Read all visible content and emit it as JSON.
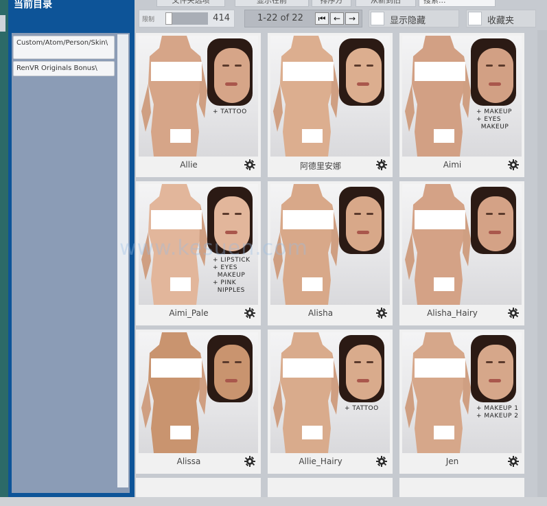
{
  "sidebar": {
    "title": "当前目录",
    "folders": [
      "Custom/Atom/Person/Skin\\",
      "RenVR Originals Bonus\\"
    ]
  },
  "toolbar": {
    "top_buttons": [
      "文件夹选项",
      "显示在前",
      "排序方",
      "从新到旧",
      "搜索..."
    ],
    "limit_label": "限制",
    "limit_value": "414",
    "pager_label": "1-22 of 22",
    "show_hidden": "显示隐藏",
    "favorites": "收藏夹"
  },
  "items": [
    {
      "name": "Allie",
      "tag": "+ TATTOO"
    },
    {
      "name": "阿德里安娜",
      "tag": ""
    },
    {
      "name": "Aimi",
      "tag": "+ MAKEUP\n+ EYES\n  MAKEUP"
    },
    {
      "name": "Aimi_Pale",
      "tag": "+ LIPSTICK\n+ EYES\n  MAKEUP\n+ PINK\n  NIPPLES"
    },
    {
      "name": "Alisha",
      "tag": ""
    },
    {
      "name": "Alisha_Hairy",
      "tag": ""
    },
    {
      "name": "Alissa",
      "tag": ""
    },
    {
      "name": "Allie_Hairy",
      "tag": "+ TATTOO"
    },
    {
      "name": "Jen",
      "tag": "+ MAKEUP 1\n+ MAKEUP 2"
    }
  ],
  "watermark": "www.kesuen.com",
  "colors": {
    "accent": "#0d5498",
    "panel": "#8b9cb6",
    "grid_bg": "#c6cad0"
  }
}
